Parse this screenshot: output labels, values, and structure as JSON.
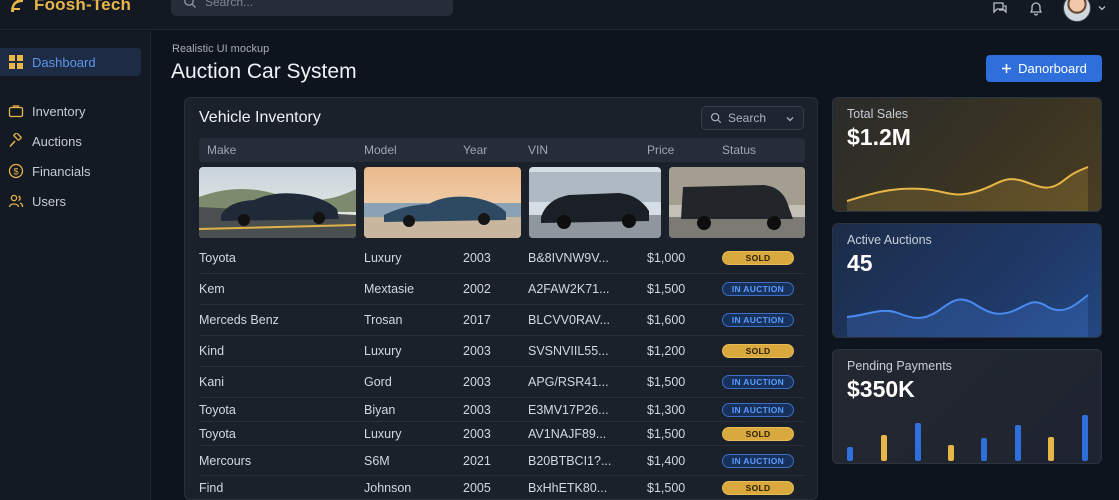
{
  "brand": {
    "name": "Foosh-Tech"
  },
  "topbar": {
    "search_placeholder": "Search..."
  },
  "sidebar": {
    "items": [
      {
        "label": "Dashboard"
      },
      {
        "label": "Inventory"
      },
      {
        "label": "Auctions"
      },
      {
        "label": "Financials"
      },
      {
        "label": "Users"
      }
    ]
  },
  "header": {
    "subtitle": "Realistic UI mockup",
    "title": "Auction Car System",
    "button_label": "Danorboard"
  },
  "inventory": {
    "title": "Vehicle Inventory",
    "search_label": "Search",
    "columns": [
      "Make",
      "Model",
      "Year",
      "VIN",
      "Price",
      "Status"
    ],
    "rows": [
      {
        "make": "Toyota",
        "model": "Luxury",
        "year": "2003",
        "vin": "B&8IVNW9V...",
        "price": "$1,000",
        "status": "SOLD"
      },
      {
        "make": "Kem",
        "model": "Mextasie",
        "year": "2002",
        "vin": "A2FAW2K71...",
        "price": "$1,500",
        "status": "IN AUCTION"
      },
      {
        "make": "Merceds Benz",
        "model": "Trosan",
        "year": "2017",
        "vin": "BLCVV0RAV...",
        "price": "$1,600",
        "status": "IN AUCTION"
      },
      {
        "make": "Kind",
        "model": "Luxury",
        "year": "2003",
        "vin": "SVSNVIIL55...",
        "price": "$1,200",
        "status": "SOLD"
      },
      {
        "make": "Kani",
        "model": "Gord",
        "year": "2003",
        "vin": "APG/RSR41...",
        "price": "$1,500",
        "status": "IN AUCTION"
      },
      {
        "make": "Toyota",
        "model": "Biyan",
        "year": "2003",
        "vin": "E3MV17P26...",
        "price": "$1,300",
        "status": "IN AUCTION"
      },
      {
        "make": "Toyota",
        "model": "Luxury",
        "year": "2003",
        "vin": "AV1NAJF89...",
        "price": "$1,500",
        "status": "SOLD"
      },
      {
        "make": "Mercours",
        "model": "S6M",
        "year": "2021",
        "vin": "B20BTBCI1?...",
        "price": "$1,400",
        "status": "IN AUCTION"
      },
      {
        "make": "Find",
        "model": "Johnson",
        "year": "2005",
        "vin": "BxHhETK80...",
        "price": "$1,500",
        "status": "SOLD"
      }
    ]
  },
  "stats": {
    "total_sales": {
      "label": "Total Sales",
      "value": "$1.2M"
    },
    "active_auctions": {
      "label": "Active Auctions",
      "value": "45"
    },
    "pending_payments": {
      "label": "Pending Payments",
      "value": "$350K"
    }
  },
  "colors": {
    "accent": "#2f6fdb",
    "brand": "#e8b547",
    "sold": "#d9a93d",
    "in_auction": "#5b9bff"
  }
}
